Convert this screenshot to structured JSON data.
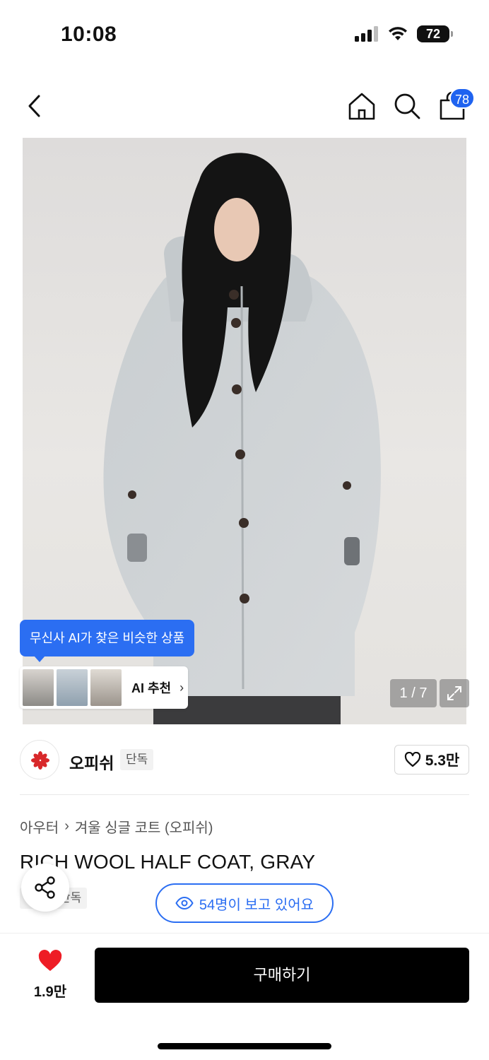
{
  "status_bar": {
    "time": "10:08",
    "battery": "72"
  },
  "nav": {
    "cart_count": "78"
  },
  "hero": {
    "ai_tip": "무신사 AI가 찾은 비슷한 상품",
    "ai_reco_label": "AI 추천",
    "pager": "1 / 7"
  },
  "brand": {
    "name": "오피쉬",
    "tag": "단독",
    "likes": "5.3만"
  },
  "product": {
    "breadcrumb_category": "아우터",
    "breadcrumb_sub": "겨울 싱글 코트 (오피쉬)",
    "title": "RICH WOOL HALF COAT, GRAY",
    "tag": "단독",
    "viewers": "54명이 보고 있어요"
  },
  "bottom": {
    "fav_count": "1.9만",
    "buy_label": "구매하기"
  },
  "colors": {
    "accent": "#2b6ef2",
    "heart": "#ee1c25",
    "buy_button": "#000000"
  }
}
